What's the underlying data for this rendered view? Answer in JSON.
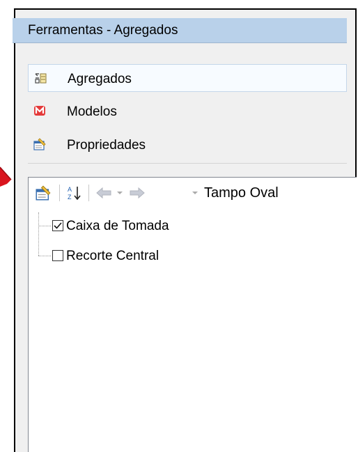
{
  "window": {
    "title": "Ferramentas - Agregados"
  },
  "accordion": {
    "items": [
      {
        "label": "Agregados",
        "icon": "aggregates-icon",
        "selected": true
      },
      {
        "label": "Modelos",
        "icon": "models-icon"
      },
      {
        "label": "Propriedades",
        "icon": "properties-icon"
      }
    ]
  },
  "toolbar": {
    "properties_icon": "properties-icon",
    "sort_icon": "sort-az-icon",
    "back_icon": "back-arrow-icon",
    "forward_icon": "forward-arrow-icon",
    "dropdown_icon": "chevron-down-icon",
    "title": "Tampo Oval"
  },
  "tree": {
    "items": [
      {
        "label": "Caixa de Tomada",
        "checked": true
      },
      {
        "label": "Recorte Central",
        "checked": false
      }
    ]
  },
  "colors": {
    "titlebar": "#b9d1ea",
    "accent_red": "#d9141e"
  }
}
